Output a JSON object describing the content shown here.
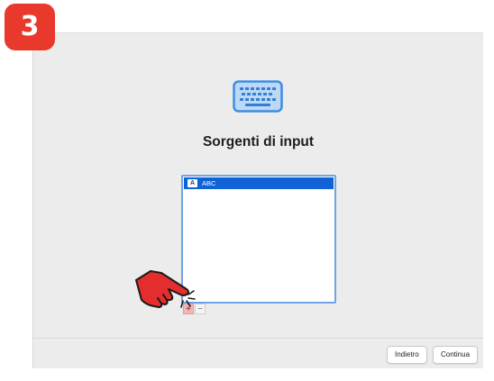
{
  "step": {
    "number": "3"
  },
  "screen": {
    "title": "Sorgenti di input",
    "icon": "keyboard-icon"
  },
  "sources": {
    "items": [
      {
        "flag": "A",
        "label": "ABC",
        "selected": true
      }
    ]
  },
  "list_controls": {
    "add_label": "+",
    "remove_label": "−"
  },
  "footer": {
    "back_label": "Indietro",
    "continue_label": "Continua"
  },
  "colors": {
    "badge": "#e9382c",
    "selection": "#0f63d6",
    "accent_blue": "#6ea3e6",
    "hand": "#e42d2d"
  }
}
